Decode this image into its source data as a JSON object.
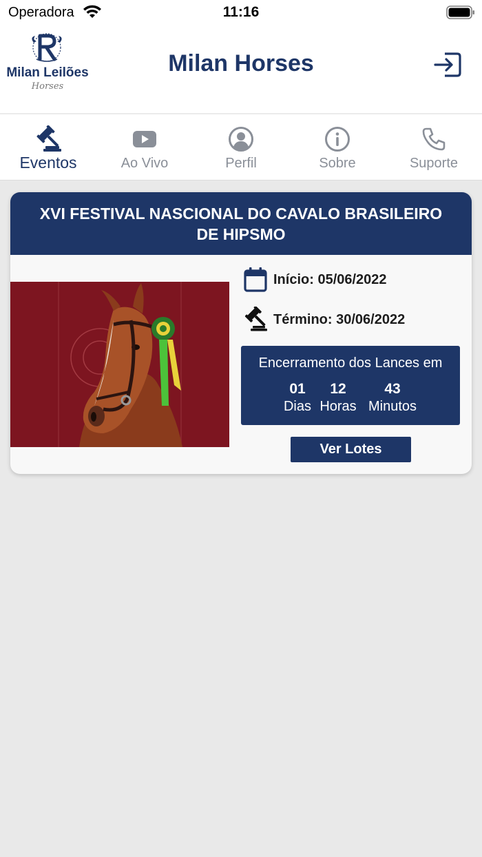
{
  "status_bar": {
    "carrier": "Operadora",
    "time": "11:16"
  },
  "header": {
    "logo_text": "Milan Leilões",
    "logo_subtext": "Horses",
    "title": "Milan Horses",
    "login_icon": "sign-in-icon"
  },
  "tabs": [
    {
      "label": "Eventos",
      "icon": "gavel-icon",
      "active": true
    },
    {
      "label": "Ao Vivo",
      "icon": "youtube-icon",
      "active": false
    },
    {
      "label": "Perfil",
      "icon": "user-circle-icon",
      "active": false
    },
    {
      "label": "Sobre",
      "icon": "info-circle-icon",
      "active": false
    },
    {
      "label": "Suporte",
      "icon": "phone-icon",
      "active": false
    }
  ],
  "event": {
    "title": "XVI FESTIVAL NASCIONAL DO CAVALO BRASILEIRO DE HIPSMO",
    "start": "Início: 05/06/2022",
    "end": "Término: 30/06/2022",
    "countdown": {
      "title": "Encerramento dos Lances em",
      "days": "01",
      "days_label": "Dias",
      "hours": "12",
      "hours_label": "Horas",
      "minutes": "43",
      "minutes_label": "Minutos"
    },
    "button": "Ver Lotes"
  },
  "colors": {
    "brand": "#1e3667",
    "inactive": "#8a8f98",
    "background": "#e9e9e9",
    "image_bg": "#7d1520"
  }
}
